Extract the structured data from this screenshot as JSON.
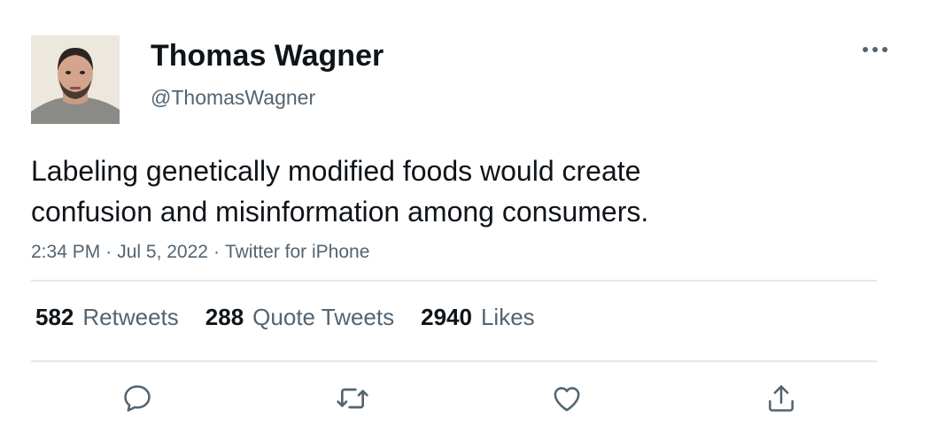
{
  "tweet": {
    "author_name": "Thomas Wagner",
    "author_handle": "@ThomasWagner",
    "text_lines": [
      "Labeling genetically modified foods would create",
      "confusion and misinformation among consumers."
    ],
    "time": "2:34 PM",
    "date": "Jul 5, 2022",
    "source": "Twitter for iPhone",
    "separator": "·"
  },
  "stats": {
    "retweets_count": "582",
    "retweets_label": "Retweets",
    "quotes_count": "288",
    "quotes_label": "Quote Tweets",
    "likes_count": "2940",
    "likes_label": "Likes"
  },
  "icons": {
    "more": "more-horizontal-icon",
    "reply": "reply-icon",
    "retweet": "retweet-icon",
    "like": "heart-icon",
    "share": "share-icon"
  },
  "colors": {
    "text_primary": "#0f1419",
    "text_secondary": "#536471",
    "divider": "#e1e8ed"
  }
}
